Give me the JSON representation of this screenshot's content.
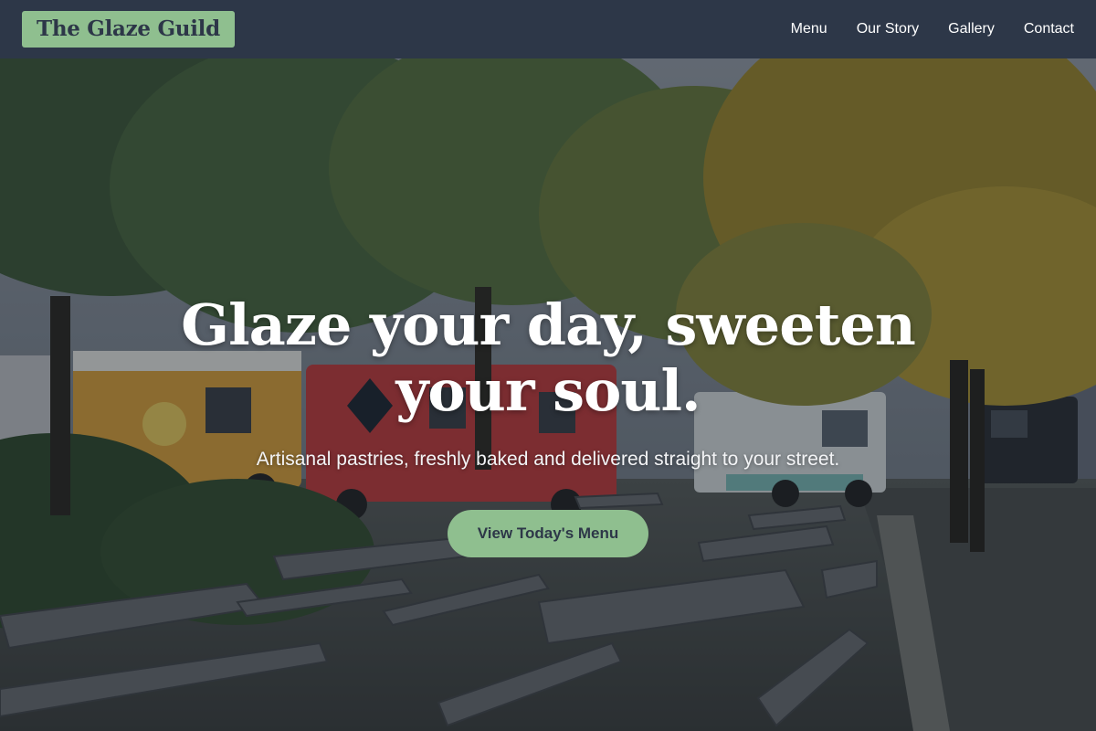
{
  "header": {
    "brand": "The Glaze Guild",
    "nav": [
      {
        "label": "Menu"
      },
      {
        "label": "Our Story"
      },
      {
        "label": "Gallery"
      },
      {
        "label": "Contact"
      }
    ]
  },
  "hero": {
    "headline": "Glaze your day, sweeten your soul.",
    "subheadline": "Artisanal pastries, freshly baked and delivered straight to your street.",
    "cta_label": "View Today's Menu",
    "background_description": "food trucks parked behind rows of wooden picnic tables under green and yellow trees"
  },
  "colors": {
    "header_bg": "#2d3748",
    "accent": "#8fbf8f",
    "accent_text": "#2d3748",
    "text_light": "#ffffff"
  }
}
